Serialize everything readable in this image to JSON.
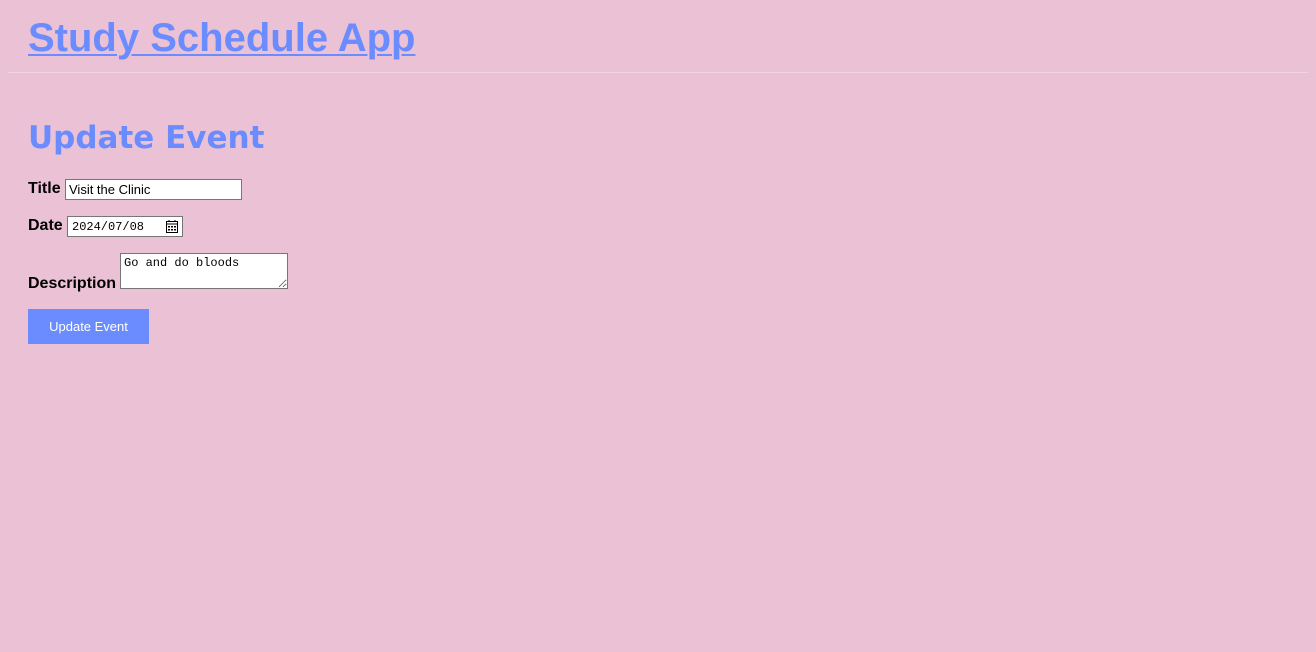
{
  "header": {
    "app_title": "Study Schedule App"
  },
  "main": {
    "heading": "Update Event",
    "form": {
      "title_label": "Title",
      "title_value": "Visit the Clinic",
      "date_label": "Date",
      "date_value": "2024/07/08",
      "description_label": "Description",
      "description_value": "Go and do bloods",
      "submit_label": "Update Event"
    }
  },
  "icons": {
    "date_picker": "calendar-icon"
  },
  "colors": {
    "background": "#ebc1d5",
    "accent": "#6a8cfe",
    "button_text": "#ffffff"
  }
}
